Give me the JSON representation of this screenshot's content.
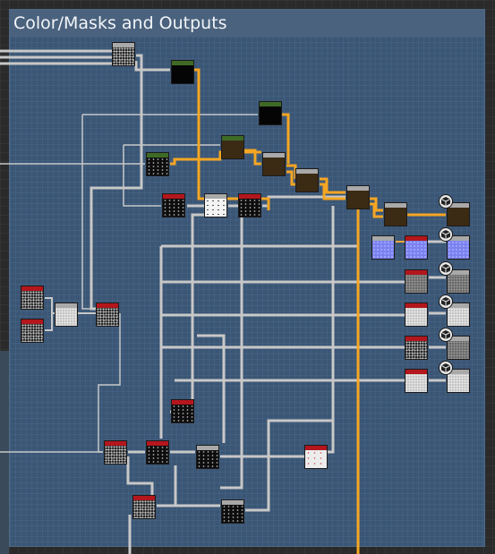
{
  "frame": {
    "title": "Color/Masks and Outputs"
  },
  "colors": {
    "frame_bg": "#3b5675",
    "wire": "#c8c8c8",
    "active_wire": "#f5a623",
    "header_red": "#b3161c",
    "header_gray": "#a9a9a9",
    "header_green": "#3e6a26"
  },
  "icons": {
    "output": "cube-icon"
  }
}
